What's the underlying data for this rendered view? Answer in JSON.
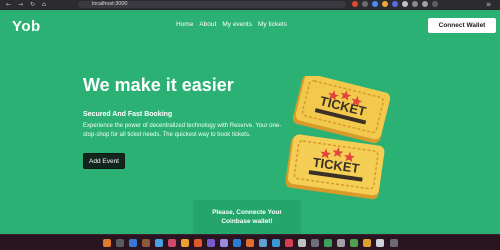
{
  "browser": {
    "url": "localhost:3000",
    "icons": [
      "back-icon",
      "forward-icon",
      "reload-icon",
      "home-icon"
    ]
  },
  "header": {
    "logo": "Yob",
    "nav": [
      "Home",
      "About",
      "My events",
      "My tickets"
    ],
    "connect_label": "Connect Wallet"
  },
  "hero": {
    "title": "We make it easier",
    "subtitle": "Secured And Fast Booking",
    "description": "Experience the power of decentralized technology with Reserve. Your one-stop-shop for all ticket needs. The quickest way to book tickets.",
    "add_event_label": "Add Event"
  },
  "wallet_notice": "Please, Connecte Your Coinbase wallet!",
  "ticket_text": "TICKET",
  "colors": {
    "page_bg": "#2bb173",
    "notice_bg": "#24a56a",
    "button_dark": "#12261d",
    "ticket_gold": "#f2c94c",
    "ticket_red": "#e2453a"
  }
}
